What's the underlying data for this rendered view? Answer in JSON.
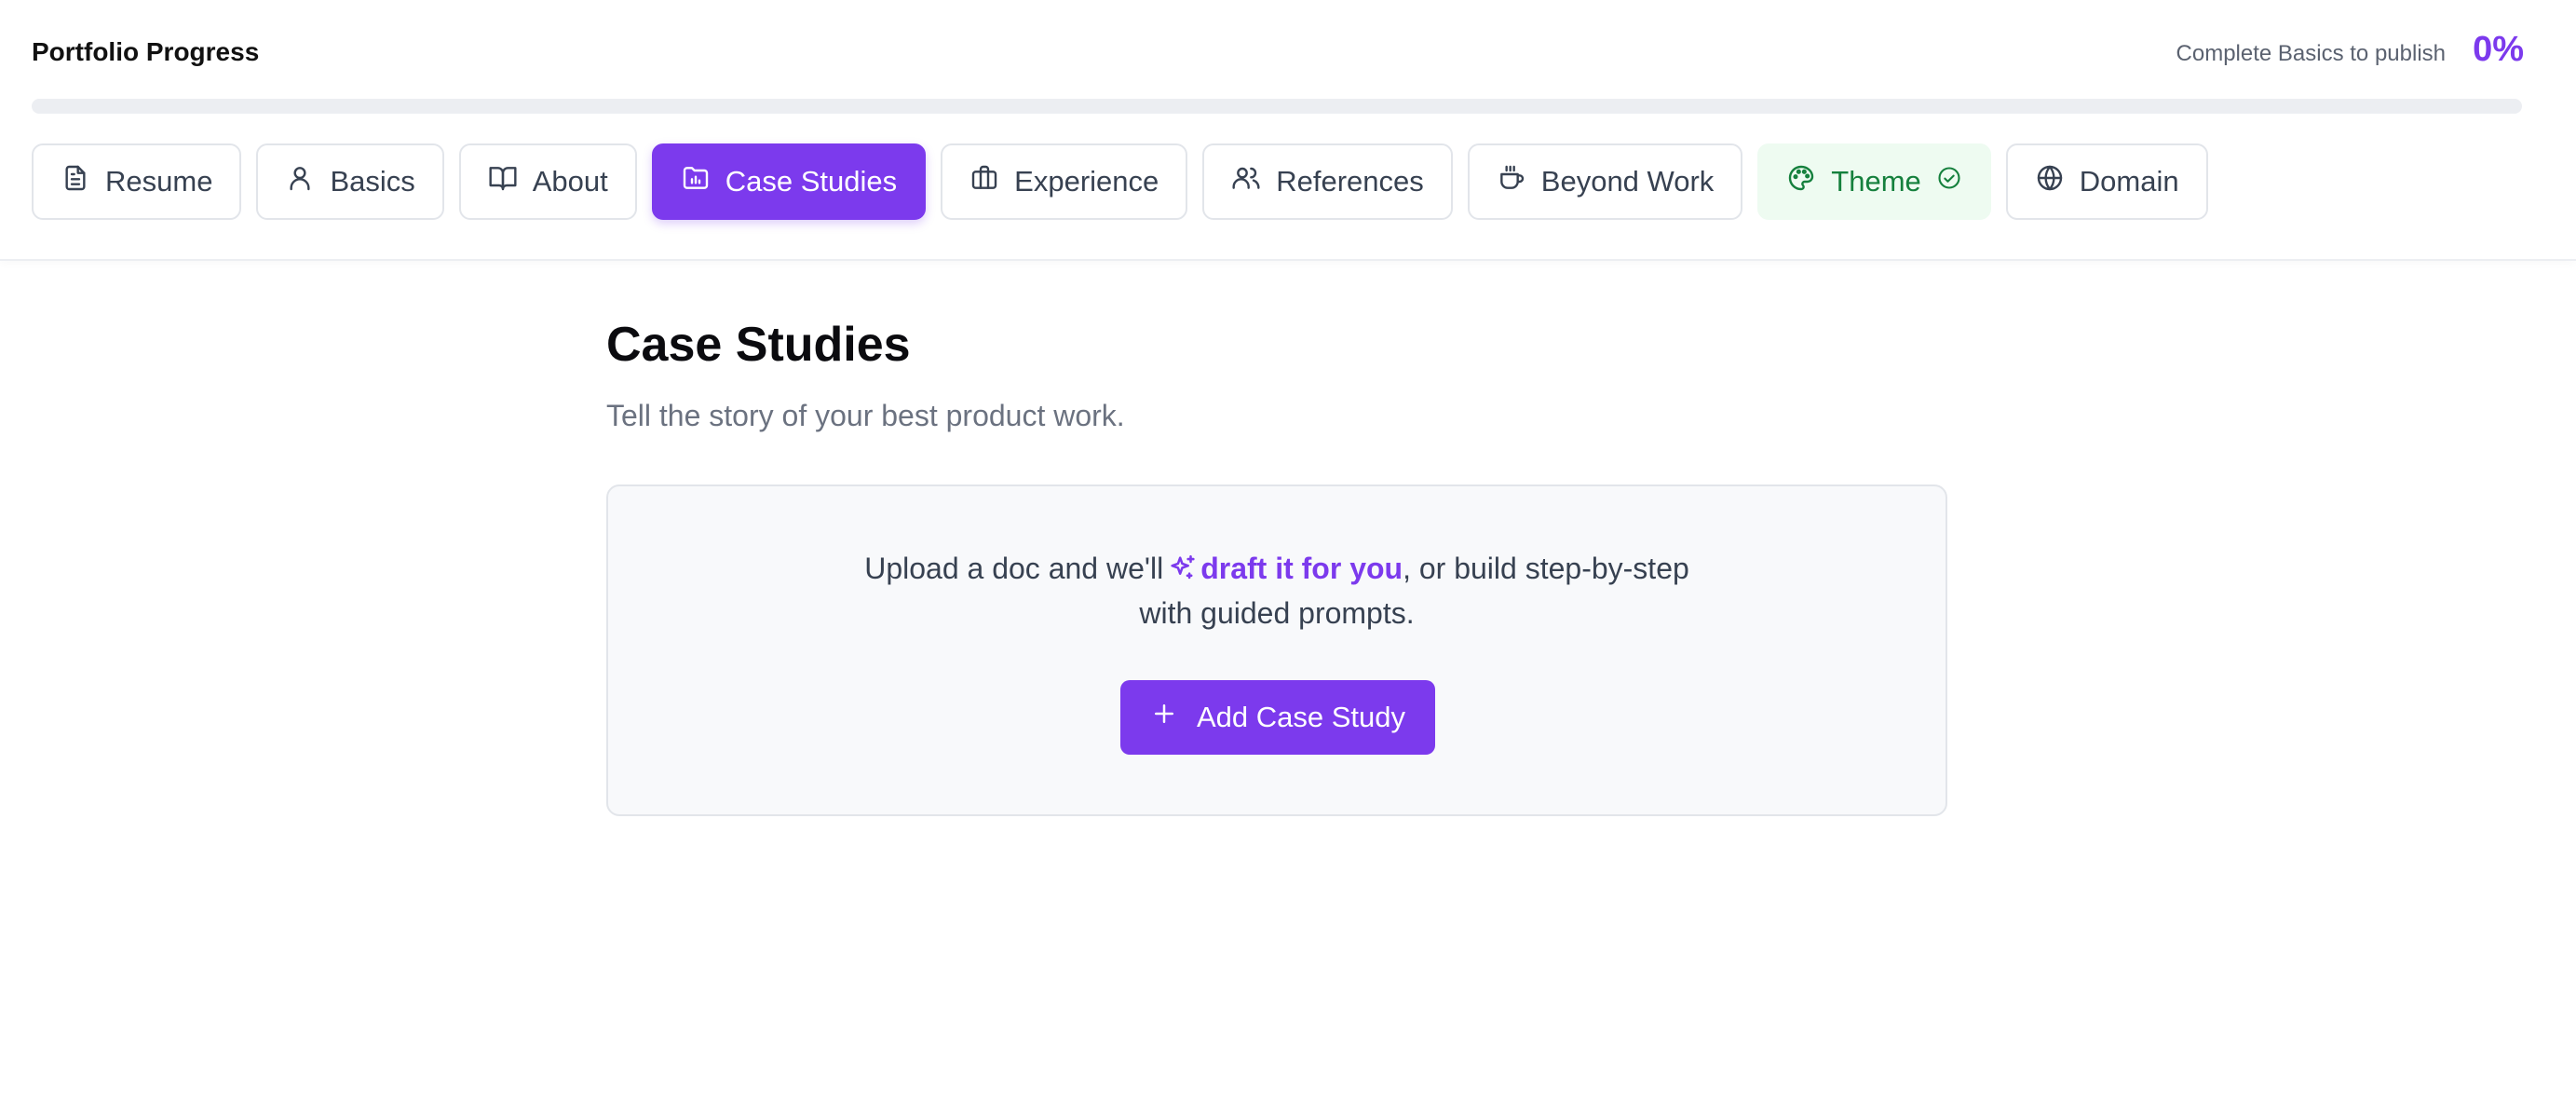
{
  "header": {
    "title": "Portfolio Progress",
    "publish_hint": "Complete Basics to publish",
    "progress_label": "0%",
    "progress_value": 0
  },
  "tabs": [
    {
      "label": "Resume",
      "icon": "document-icon",
      "state": "default"
    },
    {
      "label": "Basics",
      "icon": "user-icon",
      "state": "default"
    },
    {
      "label": "About",
      "icon": "open-book-icon",
      "state": "default"
    },
    {
      "label": "Case Studies",
      "icon": "folder-chart-icon",
      "state": "active"
    },
    {
      "label": "Experience",
      "icon": "briefcase-icon",
      "state": "default"
    },
    {
      "label": "References",
      "icon": "users-icon",
      "state": "default"
    },
    {
      "label": "Beyond Work",
      "icon": "coffee-icon",
      "state": "default"
    },
    {
      "label": "Theme",
      "icon": "palette-icon",
      "state": "completed",
      "status_icon": "check-circle-icon"
    },
    {
      "label": "Domain",
      "icon": "globe-icon",
      "state": "default"
    }
  ],
  "main": {
    "heading": "Case Studies",
    "subheading": "Tell the story of your best product work.",
    "empty_state": {
      "text_before": "Upload a doc and we'll",
      "highlight": "draft it for you",
      "text_after_line1": ", or build step-by-step",
      "text_line2": "with guided prompts.",
      "highlight_icon": "sparkles-icon",
      "button_label": "Add Case Study",
      "button_icon": "plus-icon"
    }
  },
  "colors": {
    "accent": "#7c3aed",
    "success_text": "#15803d",
    "success_bg": "#eefbf1"
  }
}
